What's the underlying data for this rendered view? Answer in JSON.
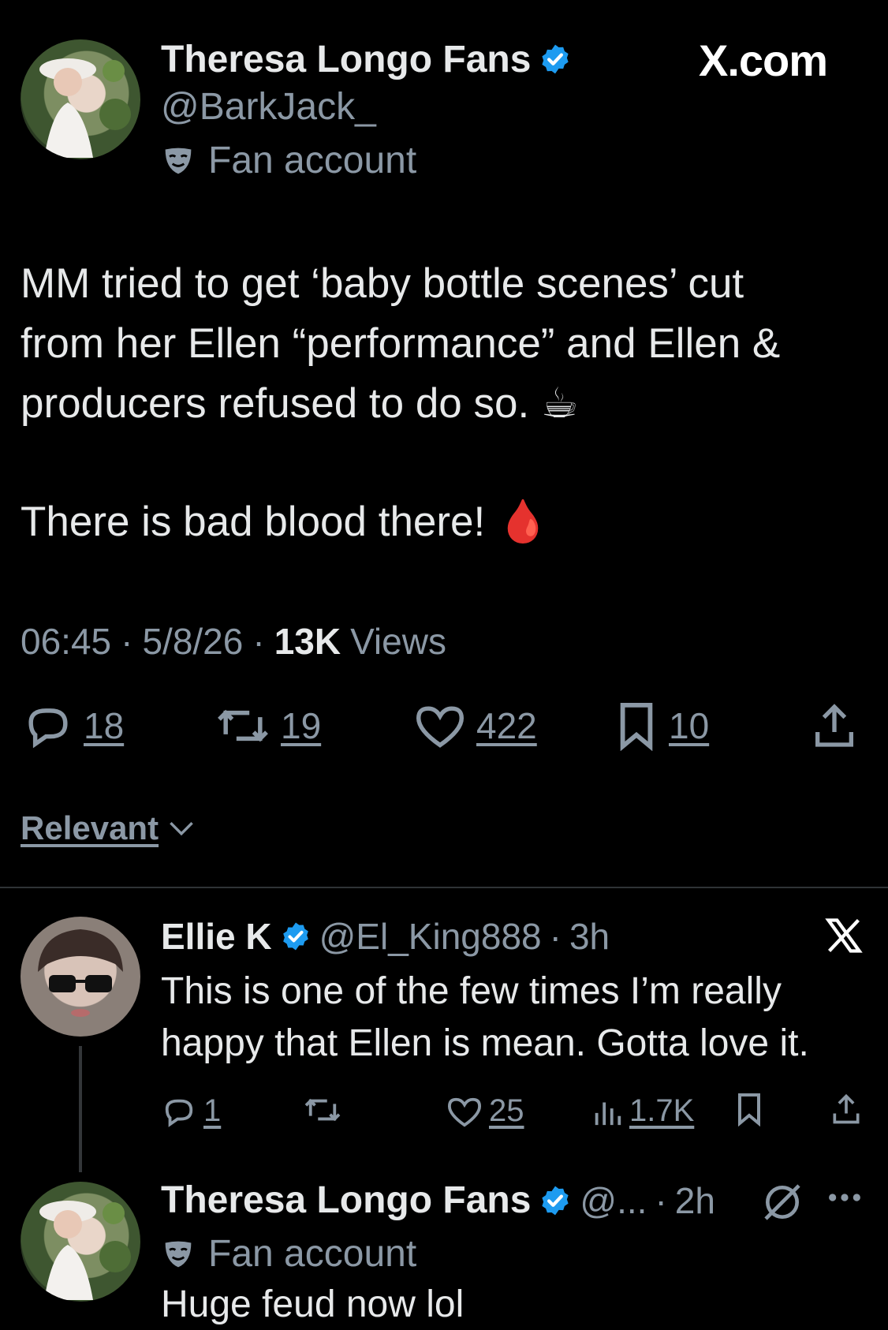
{
  "main_post": {
    "author_name": "Theresa Longo Fans",
    "handle": "@BarkJack_",
    "account_label": "Fan account",
    "site_label": "X.com",
    "text_line1": "MM tried to get ‘baby bottle scenes’ cut",
    "text_line2": "from her Ellen “performance” and Ellen &",
    "text_line3": "producers refused to do so. ☕",
    "text_line4": "There is bad blood there! 🩸",
    "time": "06:45",
    "date": "5/8/26",
    "views_count": "13K",
    "views_label": "Views",
    "sep": "·",
    "stats": {
      "replies": "18",
      "reposts": "19",
      "likes": "422",
      "bookmarks": "10"
    }
  },
  "sort": {
    "label": "Relevant"
  },
  "reply1": {
    "author_name": "Ellie K",
    "handle": "@El_King888",
    "sep": "·",
    "time": "3h",
    "text_line1": "This is one of the few times I’m really",
    "text_line2": "happy that Ellen is mean. Gotta love it.",
    "stats": {
      "replies": "1",
      "likes": "25",
      "views": "1.7K"
    }
  },
  "reply2": {
    "author_name": "Theresa Longo Fans",
    "handle": "@...",
    "sep": "·",
    "time": "2h",
    "account_label": "Fan account",
    "text": "Huge feud now lol"
  },
  "colors": {
    "verified": "#1d9bf0",
    "text": "#e7e9ea",
    "muted": "#8b98a5",
    "divider": "#2f3336"
  }
}
